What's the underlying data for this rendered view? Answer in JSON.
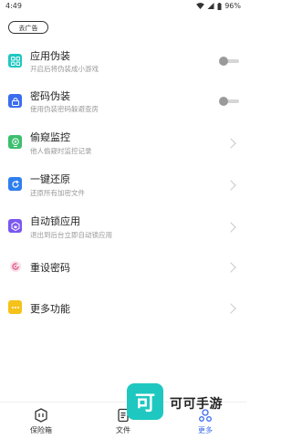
{
  "status": {
    "time": "4:49",
    "battery": "96%"
  },
  "ad_button": "去广告",
  "menu": [
    {
      "title": "应用伪装",
      "subtitle": "开启后将伪装成小游戏",
      "icon": "grid-icon",
      "color": "#1ec8c0",
      "control": "toggle"
    },
    {
      "title": "密码伪装",
      "subtitle": "使用伪装密码躲避查房",
      "icon": "lock-icon",
      "color": "#3b6cf0",
      "control": "toggle"
    },
    {
      "title": "偷窥监控",
      "subtitle": "他人偷窥时监控记录",
      "icon": "camera-icon",
      "color": "#3cbf6e",
      "control": "chevron"
    },
    {
      "title": "一键还原",
      "subtitle": "还原所有加密文件",
      "icon": "restore-icon",
      "color": "#2f7ff0",
      "control": "chevron"
    },
    {
      "title": "自动锁应用",
      "subtitle": "退出到后台立即自动锁应用",
      "icon": "hexagon-lock-icon",
      "color": "#7b57f0",
      "control": "chevron"
    },
    {
      "title": "重设密码",
      "subtitle": "",
      "icon": "reset-password-icon",
      "color": "#e85a8c",
      "control": "chevron"
    },
    {
      "title": "更多功能",
      "subtitle": "",
      "icon": "more-icon",
      "color": "#f5c21a",
      "control": "chevron"
    }
  ],
  "tabs": [
    {
      "label": "保险箱",
      "icon": "safe-icon",
      "active": false
    },
    {
      "label": "文件",
      "icon": "file-icon",
      "active": false
    },
    {
      "label": "更多",
      "icon": "more-tab-icon",
      "active": true
    }
  ],
  "watermark": {
    "text": "可可手游",
    "logo_char": "可"
  }
}
